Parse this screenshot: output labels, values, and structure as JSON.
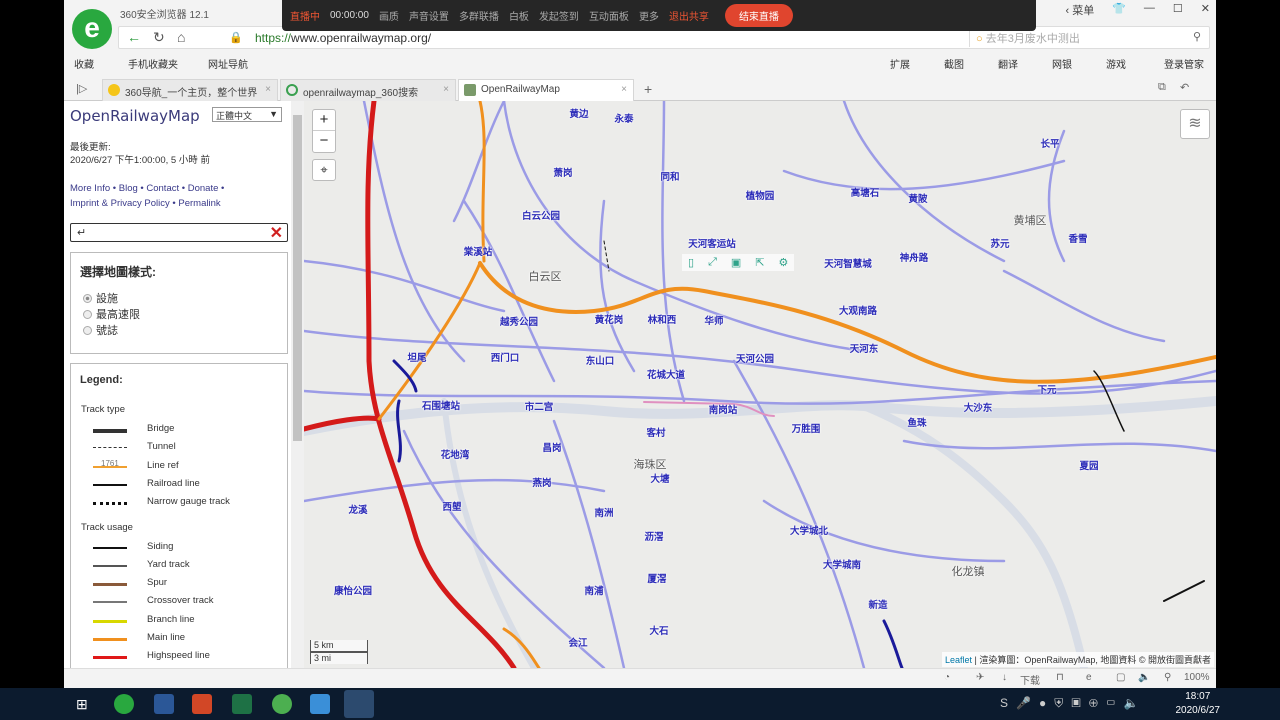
{
  "browser": {
    "app_title": "360安全浏览器 12.1",
    "url_scheme": "https://",
    "url_rest": "www.openrailwaymap.org/",
    "search_placeholder": "去年3月废水中测出",
    "menu_label": "菜单",
    "bookmarks": [
      "收藏",
      "手机收藏夹",
      "网址导航"
    ],
    "tools": [
      "扩展",
      "截图",
      "翻译",
      "网银",
      "游戏",
      "登录管家"
    ],
    "tabs": [
      {
        "label": "360导航_一个主页，整个世界"
      },
      {
        "label": "openrailwaymap_360搜索"
      },
      {
        "label": "OpenRailwayMap",
        "active": true
      }
    ]
  },
  "livebar": {
    "status": "直播中",
    "time": "00:00:00",
    "items": [
      "画质",
      "声音设置",
      "多群联播",
      "白板",
      "发起签到",
      "互动面板",
      "更多"
    ],
    "exit_share": "退出共享",
    "end_live": "结束直播"
  },
  "sidebar": {
    "title": "OpenRailwayMap",
    "language": "正體中文",
    "last_update_label": "最後更新:",
    "last_update_value": "2020/6/27 下午1:00:00, 5 小時 前",
    "links": [
      "More Info",
      "Blog",
      "Contact",
      "Donate",
      "Imprint & Privacy Policy",
      "Permalink"
    ],
    "search_value": "↵",
    "style_heading": "選擇地圖樣式:",
    "styles": [
      {
        "label": "設施",
        "selected": true
      },
      {
        "label": "最高速限"
      },
      {
        "label": "號誌"
      }
    ],
    "legend_title": "Legend:",
    "legend_sections": [
      {
        "title": "Track type",
        "items": [
          {
            "label": "Bridge",
            "color": "#333"
          },
          {
            "label": "Tunnel",
            "color": "#333"
          },
          {
            "label": "Line ref",
            "color": "#f0a030",
            "ref": "1761"
          },
          {
            "label": "Railroad line",
            "color": "#111"
          },
          {
            "label": "Narrow gauge track",
            "color": "#111"
          }
        ]
      },
      {
        "title": "Track usage",
        "items": [
          {
            "label": "Siding",
            "color": "#111"
          },
          {
            "label": "Yard track",
            "color": "#555"
          },
          {
            "label": "Spur",
            "color": "#8a5a3a"
          },
          {
            "label": "Crossover track",
            "color": "#777"
          },
          {
            "label": "Branch line",
            "color": "#d8d800"
          },
          {
            "label": "Main line",
            "color": "#f0901e"
          },
          {
            "label": "Highspeed line",
            "color": "#e01818"
          }
        ]
      }
    ]
  },
  "map": {
    "zoom_in": "+",
    "zoom_out": "−",
    "scale_km": "5 km",
    "scale_mi": "3 mi",
    "attrib_leaflet": "Leaflet",
    "attrib_rest": " | 渲染算圖：OpenRailwayMap, 地圖資料 © 開放街圖貢獻者",
    "labels": [
      "黄边",
      "永泰",
      "萧岗",
      "同和",
      "植物园",
      "高塘石",
      "黄陂",
      "黄埔区",
      "长平",
      "白云公园",
      "天河客运站",
      "苏元",
      "香雪",
      "棠溪站",
      "天河智慧城",
      "神舟路",
      "白云区",
      "大观南路",
      "越秀公园",
      "黄花岗",
      "林和西",
      "华师",
      "天河东",
      "坦尾",
      "西门口",
      "东山口",
      "天河公园",
      "花城大道",
      "下元",
      "石围塘站",
      "市二宫",
      "南岗站",
      "大沙东",
      "鱼珠",
      "万胜围",
      "客村",
      "昌岗",
      "花地湾",
      "海珠区",
      "夏园",
      "大塘",
      "燕岗",
      "西塱",
      "龙溪",
      "南洲",
      "沥滘",
      "大学城北",
      "大学城南",
      "化龙镇",
      "厦滘",
      "康怡公园",
      "南浦",
      "新造",
      "大石",
      "会江"
    ]
  },
  "statusbar": {
    "download": "下载",
    "zoom": "100%"
  },
  "taskbar": {
    "time": "18:07",
    "date": "2020/6/27"
  }
}
